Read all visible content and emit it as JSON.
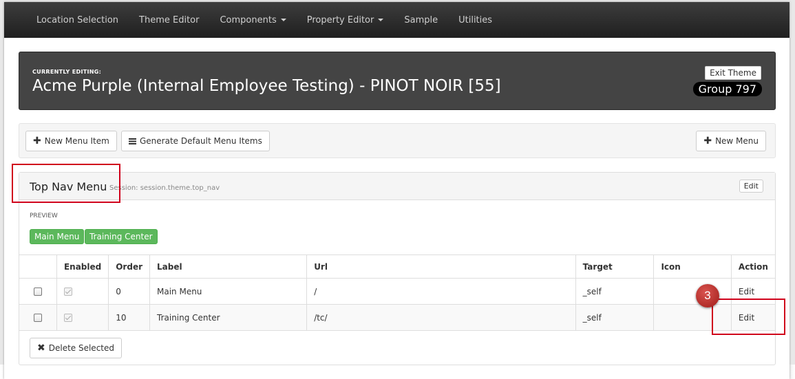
{
  "nav": {
    "items": [
      "Location Selection",
      "Theme Editor",
      "Components",
      "Property Editor",
      "Sample",
      "Utilities"
    ]
  },
  "banner": {
    "caption": "CURRENTLY EDITING:",
    "title": "Acme Purple (Internal Employee Testing) - PINOT NOIR [55]",
    "exit_label": "Exit Theme",
    "group_label": "Group 797"
  },
  "toolbar": {
    "new_menu_item": "New Menu Item",
    "generate_default": "Generate Default Menu Items",
    "new_menu": "New Menu"
  },
  "panel": {
    "title": "Top Nav Menu",
    "session": "Session: session.theme.top_nav",
    "edit_label": "Edit",
    "preview_label": "PREVIEW",
    "preview_buttons": [
      "Main Menu",
      "Training Center"
    ],
    "table": {
      "headers": [
        "",
        "Enabled",
        "Order",
        "Label",
        "Url",
        "Target",
        "Icon",
        "Action"
      ],
      "rows": [
        {
          "order": "0",
          "label": "Main Menu",
          "url": "/",
          "target": "_self",
          "icon": "",
          "action": "Edit"
        },
        {
          "order": "10",
          "label": "Training Center",
          "url": "/tc/",
          "target": "_self",
          "icon": "",
          "action": "Edit"
        }
      ]
    },
    "delete_label": "Delete Selected"
  },
  "annotation": {
    "step": "3"
  },
  "colors": {
    "navbar": "#2b2b2b",
    "banner": "#444444",
    "green": "#5cb85c",
    "annotation": "#d0021b"
  }
}
